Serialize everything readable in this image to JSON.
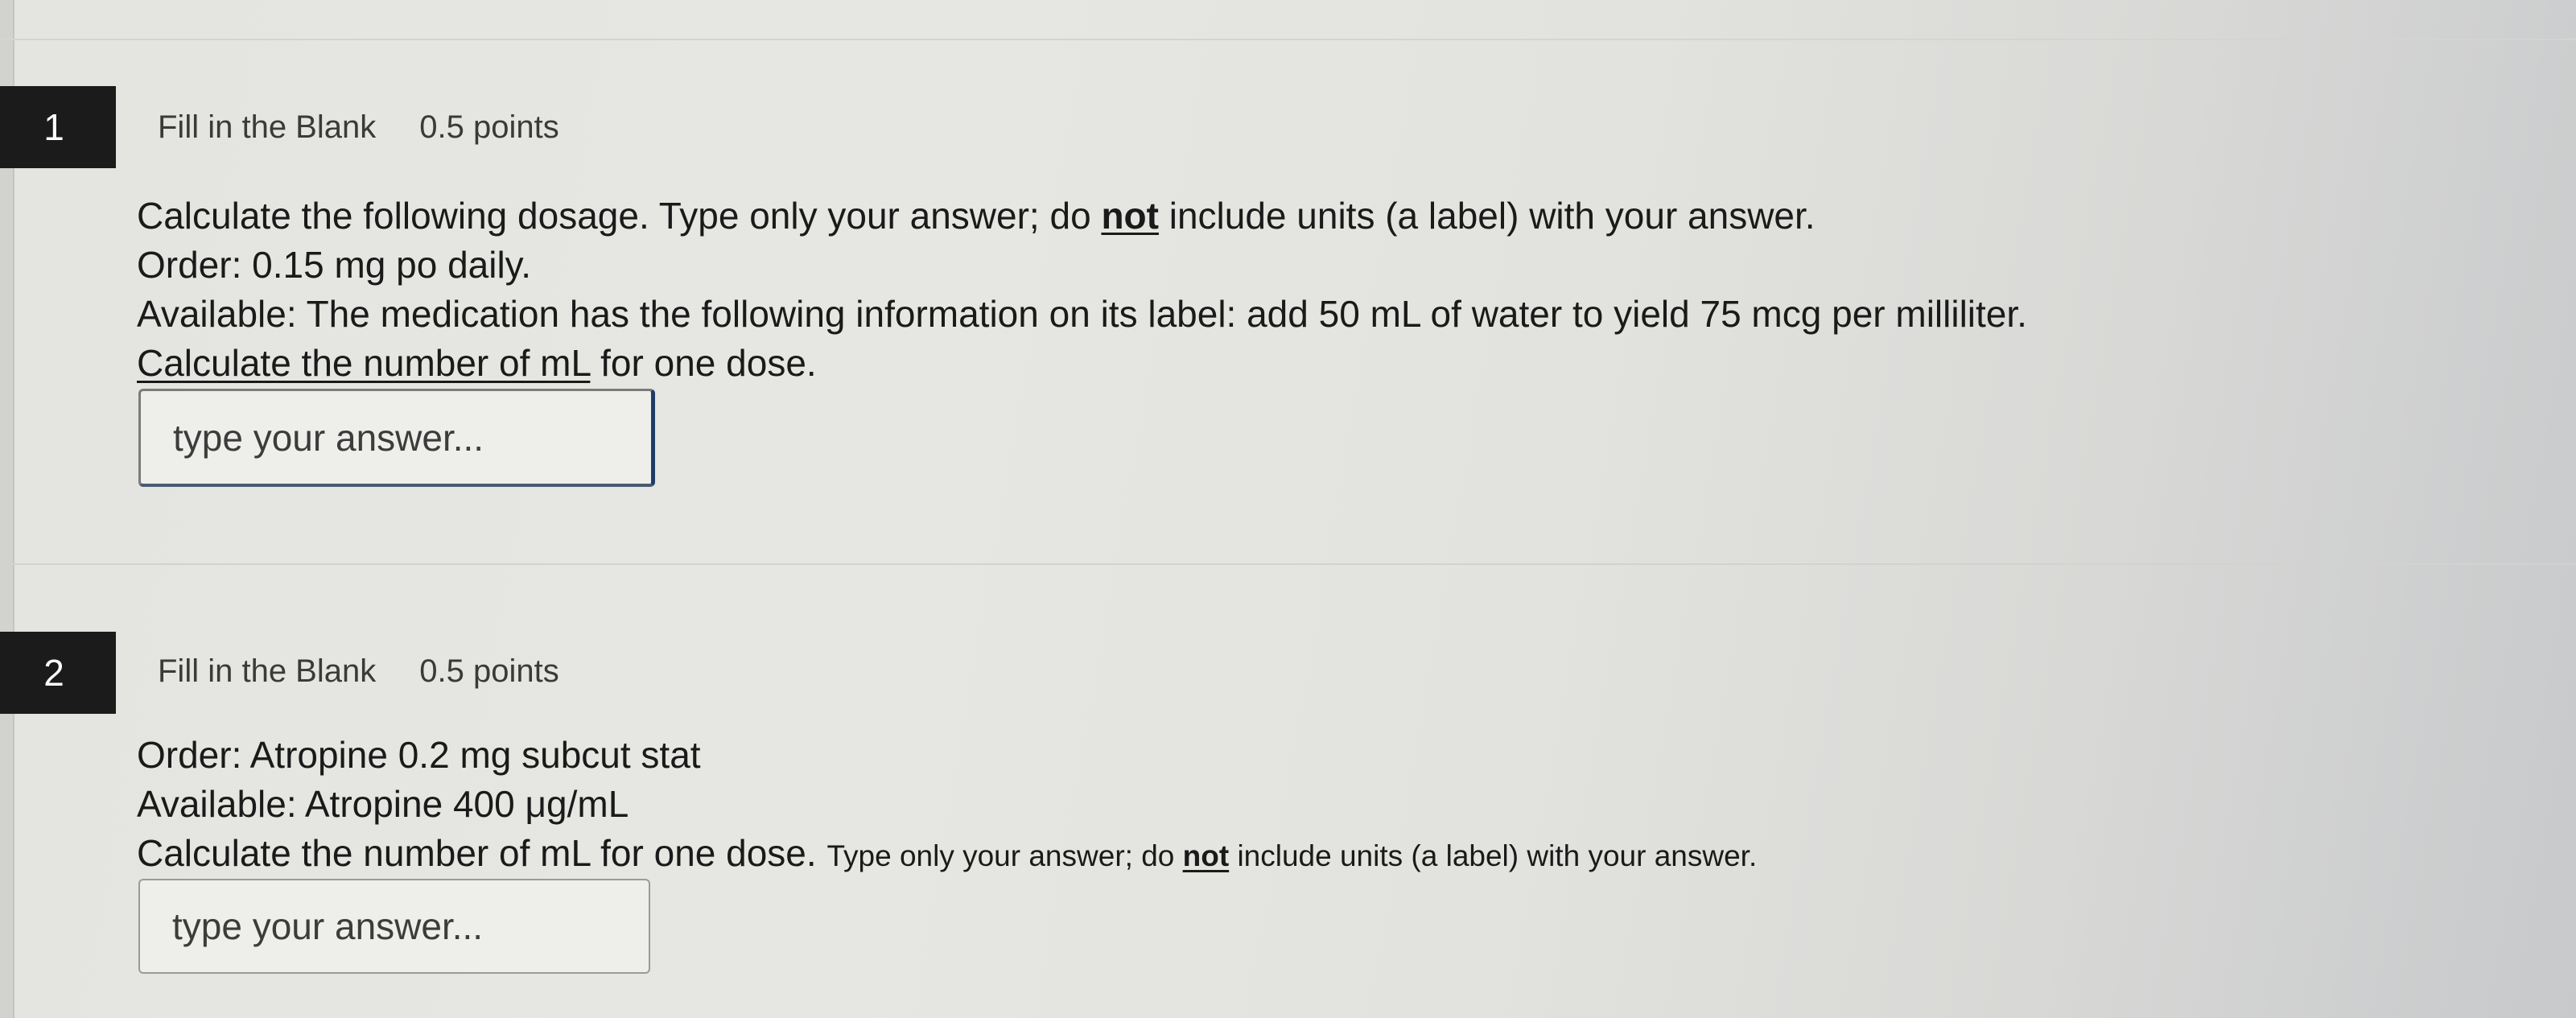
{
  "questions": [
    {
      "number": "1",
      "type": "Fill in the Blank",
      "points": "0.5 points",
      "lines": {
        "l1_a": "Calculate the following dosage.  Type only your answer; do ",
        "l1_not": "not",
        "l1_b": " include units (a label) with your answer.",
        "l2": "Order:  0.15 mg po daily.",
        "l3": "Available:  The medication has the following information on its label:  add 50 mL of water to yield 75 mcg per milliliter.",
        "l4_a": "Calculate the number of mL",
        "l4_b": " for one dose."
      },
      "answer": {
        "value": "",
        "placeholder": "type your answer..."
      }
    },
    {
      "number": "2",
      "type": "Fill in the Blank",
      "points": "0.5 points",
      "lines": {
        "l1": "Order:  Atropine 0.2 mg subcut stat",
        "l2": "Available:  Atropine 400 μg/mL",
        "l3_a": "Calculate the number of mL for one dose. ",
        "l3_b": "Type only your answer; do ",
        "l3_not": "not",
        "l3_c": " include units (a label) with your answer."
      },
      "answer": {
        "value": "",
        "placeholder": "type your answer..."
      }
    }
  ]
}
